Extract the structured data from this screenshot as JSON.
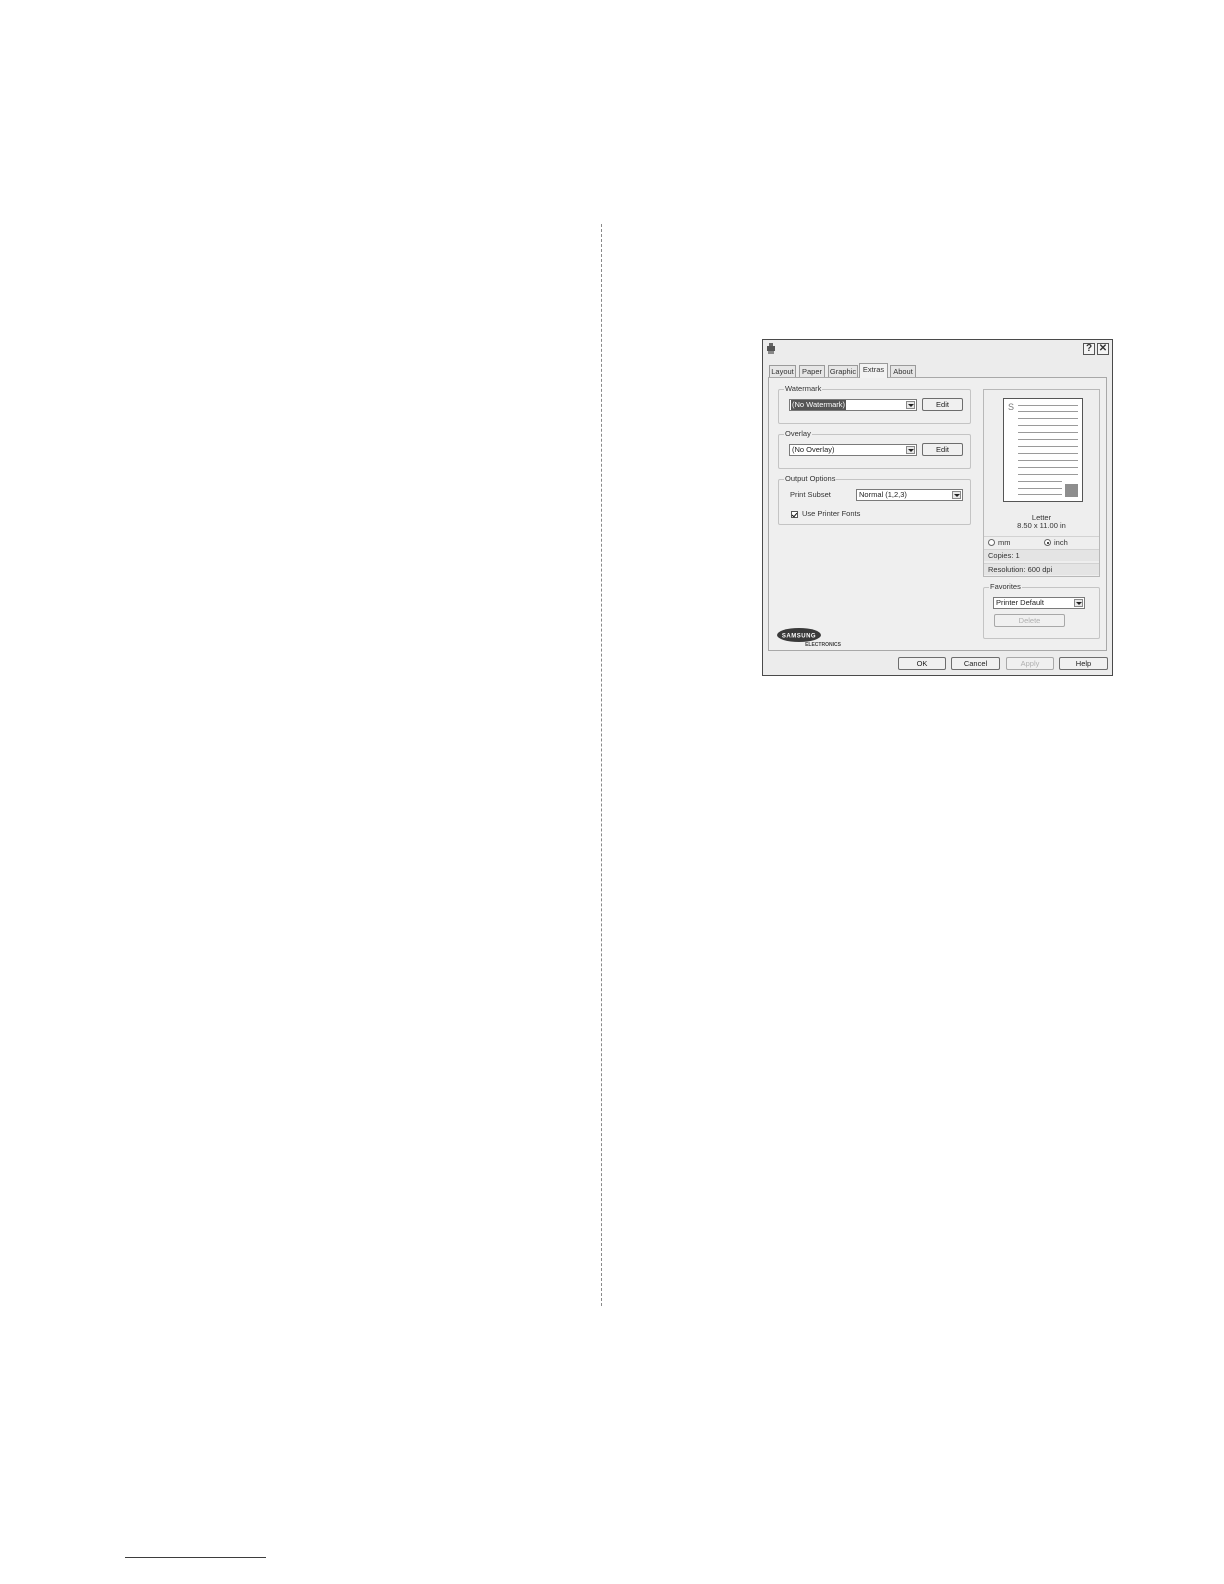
{
  "dialog": {
    "title": "",
    "tabs": [
      "Layout",
      "Paper",
      "Graphic",
      "Extras",
      "About"
    ],
    "active_tab": "Extras",
    "watermark": {
      "group_label": "Watermark",
      "value": "(No Watermark)",
      "edit_label": "Edit"
    },
    "overlay": {
      "group_label": "Overlay",
      "value": "(No Overlay)",
      "edit_label": "Edit"
    },
    "output_options": {
      "group_label": "Output Options",
      "print_subset_label": "Print Subset",
      "print_subset_value": "Normal (1,2,3)",
      "use_printer_fonts_label": "Use Printer Fonts",
      "use_printer_fonts_checked": true
    },
    "preview": {
      "page_mark": "S",
      "paper_name": "Letter",
      "paper_size": "8.50 x 11.00 in",
      "unit_mm": "mm",
      "unit_inch": "inch",
      "selected_unit": "inch",
      "copies": "Copies: 1",
      "resolution": "Resolution: 600 dpi"
    },
    "favorites": {
      "group_label": "Favorites",
      "value": "Printer Default",
      "delete_label": "Delete"
    },
    "logo": {
      "brand": "SAMSUNG",
      "sub": "ELECTRONICS"
    },
    "buttons": {
      "ok": "OK",
      "cancel": "Cancel",
      "apply": "Apply",
      "help": "Help"
    },
    "titlebar_buttons": {
      "help": "?",
      "close": "✕"
    }
  }
}
